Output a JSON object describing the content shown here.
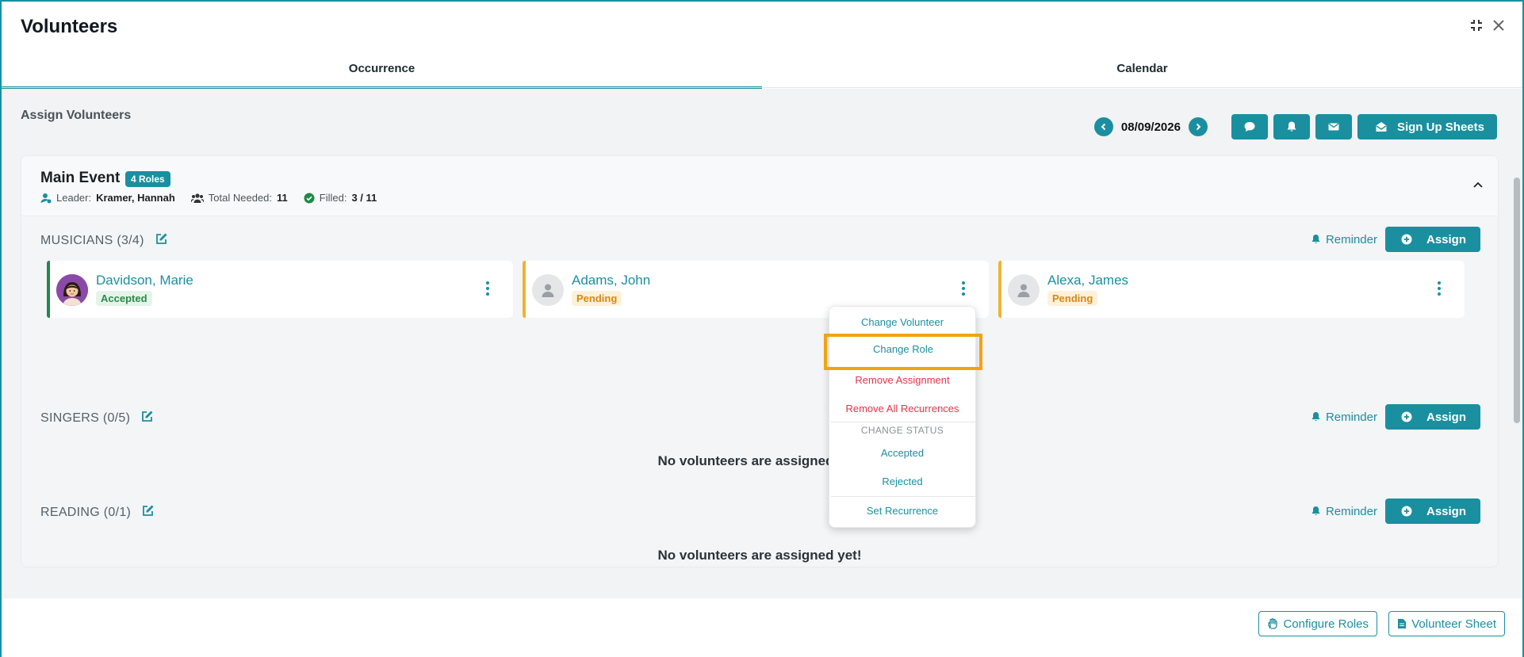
{
  "header": {
    "title": "Volunteers",
    "tabs": [
      {
        "label": "Occurrence",
        "active": true
      },
      {
        "label": "Calendar",
        "active": false
      }
    ],
    "icons": [
      "compress-icon",
      "close-icon"
    ]
  },
  "toolbar": {
    "section_title": "Assign Volunteers",
    "date": "08/09/2026",
    "signup_label": "Sign Up Sheets"
  },
  "event": {
    "title": "Main Event",
    "roles_badge": "4 Roles",
    "leader_label": "Leader:",
    "leader": "Kramer, Hannah",
    "total_label": "Total Needed:",
    "total": "11",
    "filled_label": "Filled:",
    "filled": "3 / 11"
  },
  "sections": [
    {
      "title": "MUSICIANS (3/4)",
      "reminder": "Reminder",
      "assign": "Assign",
      "volunteers": [
        {
          "name": "Davidson, Marie",
          "status": "Accepted"
        },
        {
          "name": "Adams, John",
          "status": "Pending"
        },
        {
          "name": "Alexa, James",
          "status": "Pending"
        }
      ]
    },
    {
      "title": "SINGERS (0/5)",
      "reminder": "Reminder",
      "assign": "Assign",
      "empty": "No volunteers are assigned yet!"
    },
    {
      "title": "READING (0/1)",
      "reminder": "Reminder",
      "assign": "Assign",
      "empty": "No volunteers are assigned yet!"
    }
  ],
  "menu": {
    "items": [
      {
        "label": "Change Volunteer"
      },
      {
        "label": "Change Role",
        "highlighted": true
      },
      {
        "label": "Remove Assignment"
      },
      {
        "label": "Remove All Recurrences"
      }
    ],
    "status_header": "CHANGE STATUS",
    "status_items": [
      {
        "label": "Accepted"
      },
      {
        "label": "Rejected"
      }
    ],
    "set_recurrence": "Set Recurrence"
  },
  "footer": {
    "configure_roles": "Configure Roles",
    "volunteer_sheet": "Volunteer Sheet"
  },
  "colors": {
    "accent": "#1a8fa0",
    "accepted": "#1f8a48",
    "pending": "#f2b233",
    "danger": "#e4344b",
    "highlight": "#f2a40f"
  }
}
